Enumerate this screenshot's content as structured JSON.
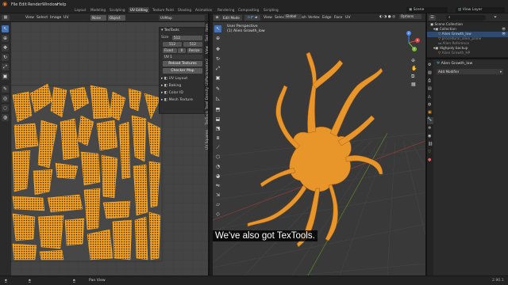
{
  "app": {
    "menu": [
      "File",
      "Edit",
      "Render",
      "Window",
      "Help"
    ],
    "workspaces": [
      "Layout",
      "Modeling",
      "Sculpting",
      "UV Editing",
      "Texture Paint",
      "Shading",
      "Animation",
      "Rendering",
      "Compositing",
      "Scripting"
    ],
    "active_workspace": "UV Editing",
    "scene": "Scene",
    "view_layer": "View Layer"
  },
  "uv_editor": {
    "header": [
      "View",
      "Select",
      "Image",
      "UV"
    ],
    "image_name": "UVMap",
    "pivot_labels": [
      "None",
      "Object"
    ],
    "sidebar_tabs": [
      "Tool",
      "Image",
      "View",
      "TexTools"
    ],
    "textools": {
      "title": "TexTools",
      "size_label": "Size",
      "size_value": "512",
      "dims": [
        "512",
        "512"
      ],
      "pad_label": "Fixed",
      "pad_value": "0",
      "resize_label": "Resize",
      "uv_label": "UV",
      "uv_value": "1",
      "reload_label": "Reload Textures",
      "checker_label": "Checker Map",
      "sections": [
        "UV Layout",
        "Baking",
        "Color ID",
        "Mesh Texture"
      ]
    }
  },
  "viewport": {
    "mode": "Edit Mode",
    "header_menus": [
      "View",
      "Select",
      "Add",
      "Mesh",
      "Vertex",
      "Edge",
      "Face",
      "UV"
    ],
    "orientation": "Global",
    "options_label": "Options",
    "perspective": "User Perspective",
    "object_label": "(1) Alien Growth_low",
    "side_tabs": [
      "Item",
      "Tool",
      "View",
      "UVPackmaster2",
      "Texel Density",
      "TexTools",
      "UV Squares"
    ]
  },
  "outliner": {
    "rows": [
      {
        "label": "Scene Collection"
      },
      {
        "label": "Collection"
      },
      {
        "label": "Alien Growth_low"
      },
      {
        "label": "procedural_alien_plane"
      },
      {
        "label": "Alien Reference"
      },
      {
        "label": "Highpoly backup"
      },
      {
        "label": "Alien Growth_HP"
      }
    ]
  },
  "properties": {
    "object_name": "Alien Growth_low",
    "add_modifier": "Add Modifier"
  },
  "status": {
    "left": "Pan View",
    "version": "2.90.1"
  },
  "subtitle": "We've also got TexTools.",
  "colors": {
    "accent": "#4772b3",
    "uv_orange": "#f0a020",
    "mesh_orange": "#e8962a",
    "grid": "#3a3a3a"
  }
}
